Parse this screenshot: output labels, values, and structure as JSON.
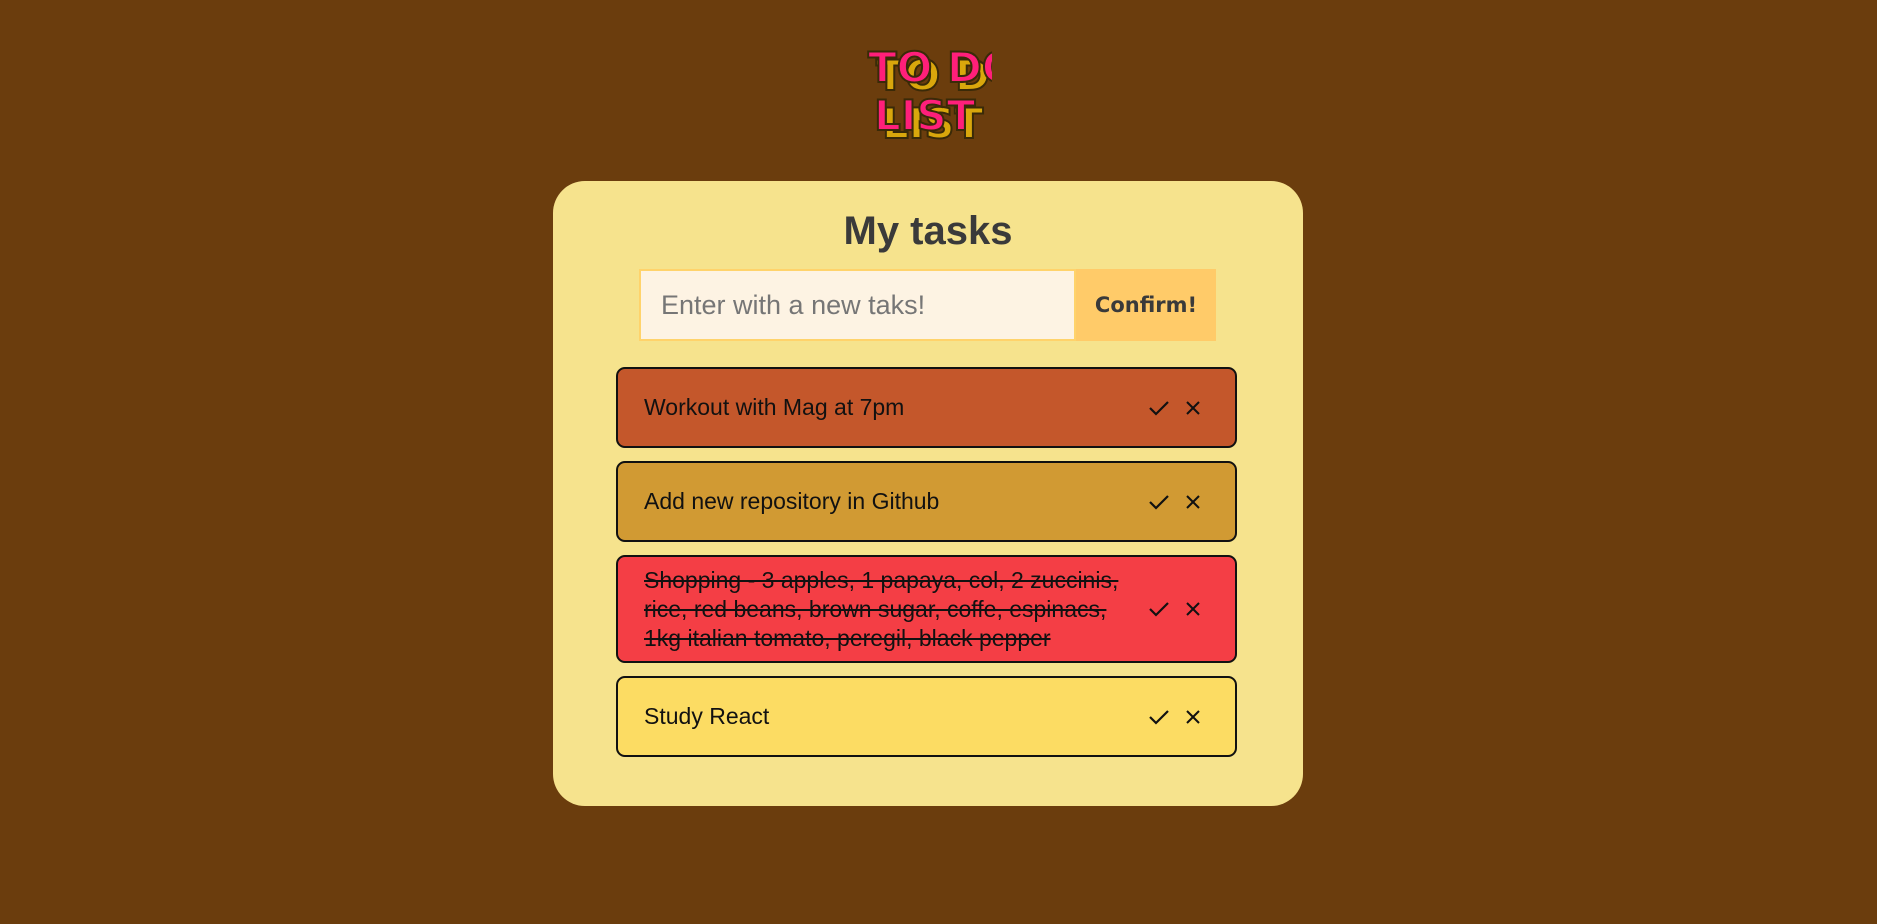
{
  "logo": {
    "line1": "TO DO",
    "line2": "LIST",
    "colors": {
      "fill": "#ff1f7a",
      "shadow": "#d9a70c",
      "outline": "#3a2a08"
    }
  },
  "header": {
    "title": "My tasks"
  },
  "new_task": {
    "placeholder": "Enter with a new taks!",
    "confirm_label": "Confirm!"
  },
  "tasks": [
    {
      "text": "Workout with Mag at 7pm",
      "color": "#c4572b",
      "done": false
    },
    {
      "text": "Add new repository in Github",
      "color": "#d19a33",
      "done": false
    },
    {
      "text": "Shopping - 3 apples, 1 papaya, col, 2 zuccinis, rice, red beans, brown sugar, coffe, espinacs, 1kg italian tomato, peregil, black pepper",
      "color": "#f43e45",
      "done": true
    },
    {
      "text": "Study React",
      "color": "#fcdc63",
      "done": false
    }
  ],
  "icons": {
    "complete": "check-icon",
    "delete": "close-icon"
  },
  "colors": {
    "page_bg": "#6b3d0d",
    "card_bg": "#f6e38d",
    "button_bg": "#ffcb69",
    "input_bg": "#fdf3e3"
  }
}
